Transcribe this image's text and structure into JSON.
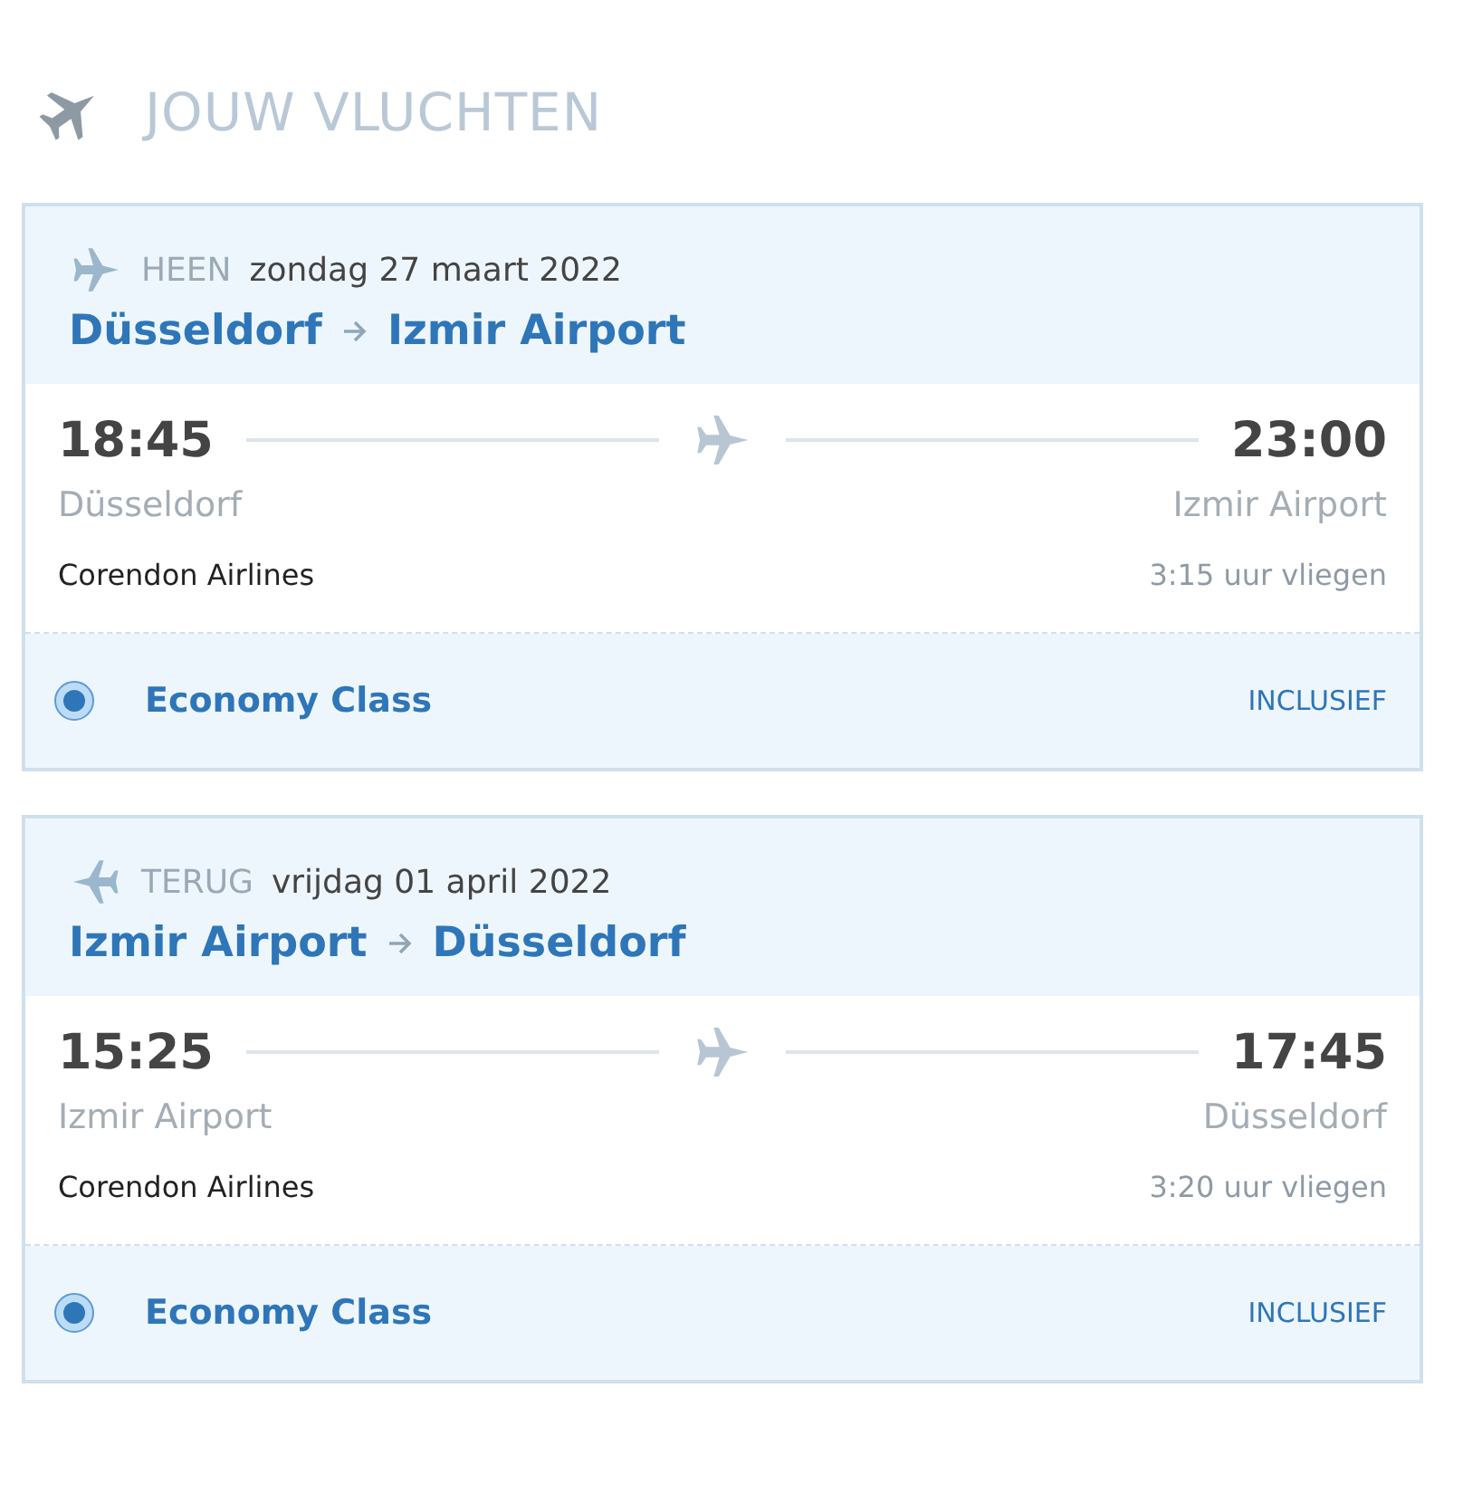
{
  "heading": "JOUW VLUCHTEN",
  "flights": [
    {
      "kind": "outbound",
      "label": "HEEN",
      "date": "zondag 27 maart 2022",
      "from": "Düsseldorf",
      "to": "Izmir Airport",
      "depart_time": "18:45",
      "arrive_time": "23:00",
      "depart_place": "Düsseldorf",
      "arrive_place": "Izmir Airport",
      "airline": "Corendon Airlines",
      "duration": "3:15 uur vliegen",
      "class": {
        "name": "Economy Class",
        "selected": true,
        "price": "INCLUSIEF"
      }
    },
    {
      "kind": "return",
      "label": "TERUG",
      "date": "vrijdag 01 april 2022",
      "from": "Izmir Airport",
      "to": "Düsseldorf",
      "depart_time": "15:25",
      "arrive_time": "17:45",
      "depart_place": "Izmir Airport",
      "arrive_place": "Düsseldorf",
      "airline": "Corendon Airlines",
      "duration": "3:20 uur vliegen",
      "class": {
        "name": "Economy Class",
        "selected": true,
        "price": "INCLUSIEF"
      }
    }
  ]
}
